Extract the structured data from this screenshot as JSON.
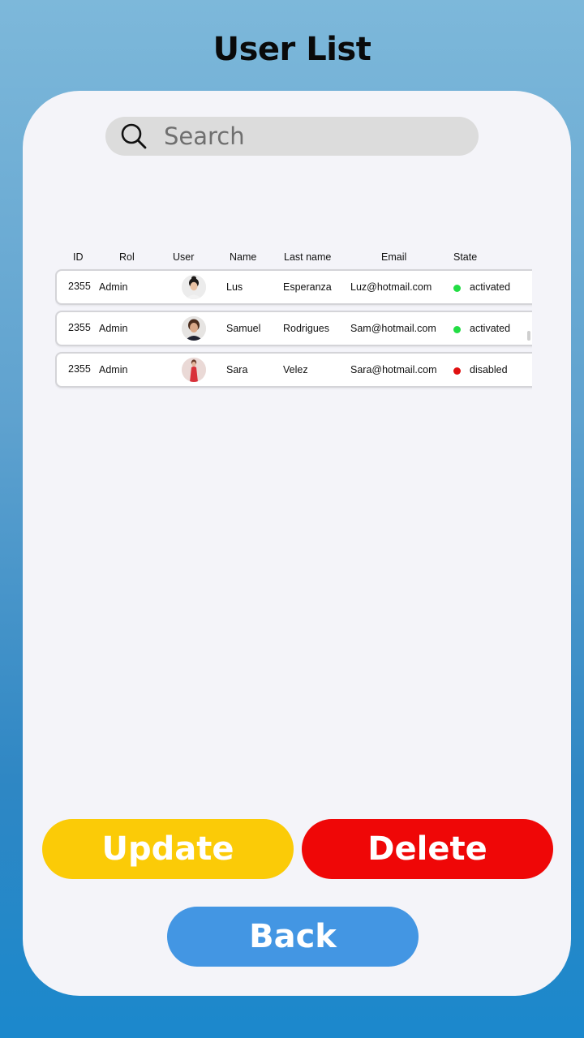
{
  "header": {
    "title": "User List"
  },
  "search": {
    "placeholder": "Search",
    "icon": "search-icon"
  },
  "table": {
    "columns": [
      "ID",
      "Rol",
      "User",
      "Name",
      "Last name",
      "Email",
      "State"
    ],
    "rows": [
      {
        "id": "2355",
        "rol": "Admin",
        "user_avatar": "avatar-woman-dark-hair",
        "name": "Lus",
        "last_name": "Esperanza",
        "email": "Luz@hotmail.com",
        "state": "activated",
        "state_color": "#22dd44"
      },
      {
        "id": "2355",
        "rol": "Admin",
        "user_avatar": "avatar-man-brown-hair",
        "name": "Samuel",
        "last_name": "Rodrigues",
        "email": "Sam@hotmail.com",
        "state": "activated",
        "state_color": "#22dd44"
      },
      {
        "id": "2355",
        "rol": "Admin",
        "user_avatar": "avatar-woman-red-dress",
        "name": "Sara",
        "last_name": "Velez",
        "email": "Sara@hotmail.com",
        "state": "disabled",
        "state_color": "#e01010"
      }
    ]
  },
  "actions": {
    "update_label": "Update",
    "delete_label": "Delete",
    "back_label": "Back"
  },
  "colors": {
    "update": "#fbcb07",
    "delete": "#ef0707",
    "back": "#4396e3"
  }
}
